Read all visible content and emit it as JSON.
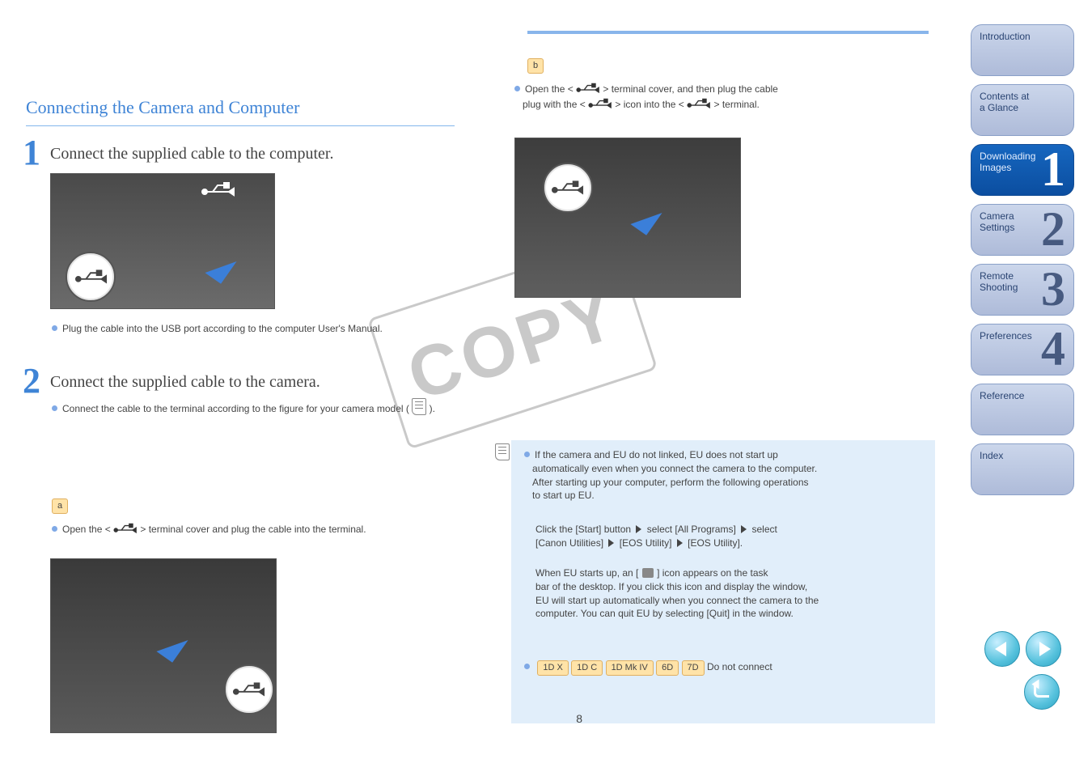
{
  "watermark": "COPY",
  "page_number": "8",
  "left": {
    "heading": "Connecting the Camera and Computer",
    "step1": {
      "num": "1",
      "title": "Connect the supplied cable to the computer.",
      "bullet": "Plug the cable into the USB port according to the computer User's Manual."
    },
    "step2": {
      "num": "2",
      "title": "Connect the supplied cable to the camera.",
      "bullet_intro": "Connect the cable to the terminal according to the figure for your camera model (",
      "icon_labels": [
        "",
        "",
        "",
        "",
        "",
        "",
        ""
      ],
      "bullet_close": ").",
      "group_a_label": "a",
      "group_a_text": "Open the <USB> terminal cover and plug the cable into the terminal.",
      "group_b_label": "b",
      "group_b_text_l1": "Open the <USB>     terminal cover, and then plug the cable",
      "group_b_text_l2": "plug with the <USB>     icon into the <USB>     terminal.",
      "group_b_text_r": "terminal."
    }
  },
  "right_note": {
    "para1_1": "If the camera and EU do not linked, EU does not start up",
    "para1_2": "automatically even when you connect the camera to the computer.",
    "para1_3": "After starting up your computer, perform the following operations",
    "para1_4": "to start up EU.",
    "path": [
      "Click the [Start] button",
      "select [All Programs]",
      "select",
      "[Canon Utilities]",
      "[EOS Utility]",
      "[EOS Utility]."
    ],
    "para2_1": "When EU starts up, an [",
    "para2_2": "] icon appears on the task",
    "para2_3": "bar of the desktop. If you click this icon and display the window,",
    "para2_4": "EU will start up automatically when you connect the camera to the",
    "para2_5": "computer. You can quit EU by selecting [Quit] in the window.",
    "badges_row": [
      "1D X",
      "1D C",
      "1D Mk IV",
      "6D",
      "7D"
    ],
    "badges_row_after": " Do not connect"
  },
  "sidebar": {
    "items": [
      {
        "big": "",
        "small": "Introduction"
      },
      {
        "big": "",
        "small": "Contents at\na Glance"
      },
      {
        "big": "1",
        "small": "Downloading\nImages"
      },
      {
        "big": "2",
        "small": "Camera\nSettings"
      },
      {
        "big": "3",
        "small": "Remote\nShooting"
      },
      {
        "big": "4",
        "small": "Preferences"
      },
      {
        "big": "",
        "small": "Reference"
      },
      {
        "big": "",
        "small": "Index"
      }
    ]
  }
}
